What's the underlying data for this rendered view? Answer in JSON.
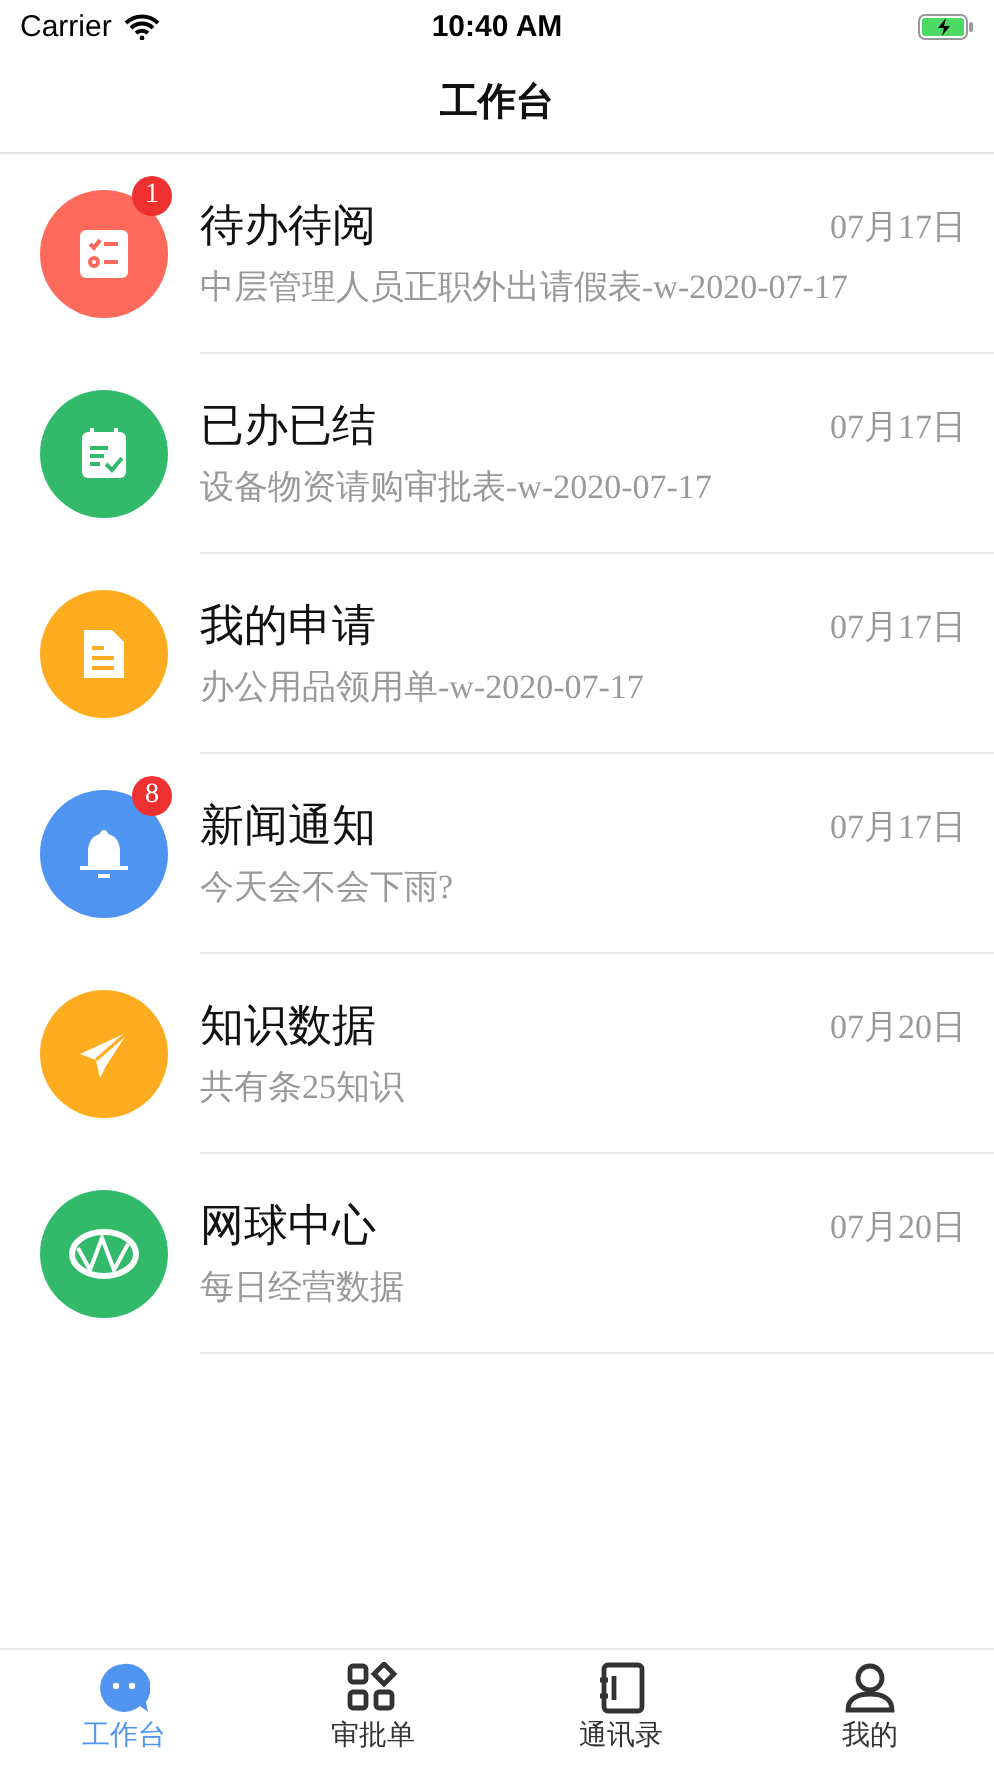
{
  "status_bar": {
    "carrier": "Carrier",
    "time": "10:40 AM"
  },
  "header": {
    "title": "工作台"
  },
  "items": [
    {
      "kind": "todo",
      "color": "#fd6a5c",
      "title": "待办待阅",
      "subtitle": "中层管理人员正职外出请假表-w-2020-07-17",
      "date": "07月17日",
      "badge": "1"
    },
    {
      "kind": "done",
      "color": "#33b96a",
      "title": "已办已结",
      "subtitle": "设备物资请购审批表-w-2020-07-17",
      "date": "07月17日"
    },
    {
      "kind": "document",
      "color": "#fdab1f",
      "title": "我的申请",
      "subtitle": "办公用品领用单-w-2020-07-17",
      "date": "07月17日"
    },
    {
      "kind": "bell",
      "color": "#4f94f1",
      "title": "新闻通知",
      "subtitle": "今天会不会下雨?",
      "date": "07月17日",
      "badge": "8"
    },
    {
      "kind": "plane",
      "color": "#fdab1f",
      "title": "知识数据",
      "subtitle": "共有条25知识",
      "date": "07月20日"
    },
    {
      "kind": "globe",
      "color": "#33b96a",
      "title": "网球中心",
      "subtitle": "每日经营数据",
      "date": "07月20日"
    }
  ],
  "tab_bar": [
    {
      "kind": "chat",
      "label": "工作台",
      "selected": true
    },
    {
      "kind": "grid",
      "label": "审批单",
      "selected": false
    },
    {
      "kind": "book",
      "label": "通讯录",
      "selected": false
    },
    {
      "kind": "person",
      "label": "我的",
      "selected": false
    }
  ]
}
